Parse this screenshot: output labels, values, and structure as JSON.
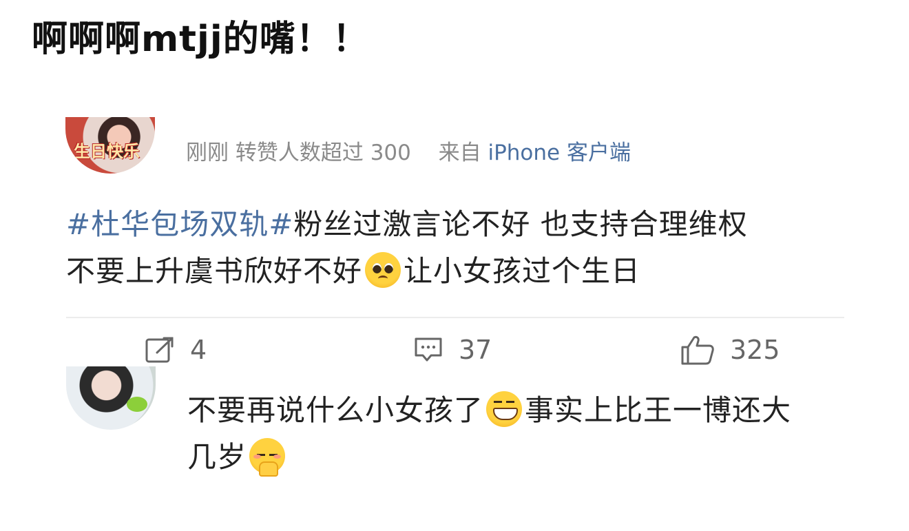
{
  "overlay": {
    "caption": "啊啊啊mtjj的嘴！！"
  },
  "post": {
    "avatar_text": "生日快乐",
    "meta_time": "刚刚",
    "meta_reposts": "转赞人数超过 300",
    "meta_from": "来自",
    "meta_client": "iPhone 客户端",
    "hashtag_1": "#杜华包场双轨#",
    "body_line_1": "粉丝过激言论不好 也支持合理维权",
    "body_line_2a": "不要上升虞书欣好不好",
    "body_line_2b": "让小女孩过个生日",
    "emoji_1": "pleading-face-emoji"
  },
  "actions": {
    "repost_count": "4",
    "comment_count": "37",
    "like_count": "325",
    "repost_icon": "share-icon",
    "comment_icon": "comment-icon",
    "like_icon": "thumbs-up-icon"
  },
  "reply": {
    "text_a": "不要再说什么小女孩了",
    "text_b": "事实上比王一博还大",
    "text_c": "几岁",
    "emoji_1": "grinning-face-emoji",
    "emoji_2": "shy-face-emoji"
  },
  "colors": {
    "link_blue": "#4a6fa0",
    "meta_gray": "#8a8a8a",
    "text_dark": "#222222"
  }
}
